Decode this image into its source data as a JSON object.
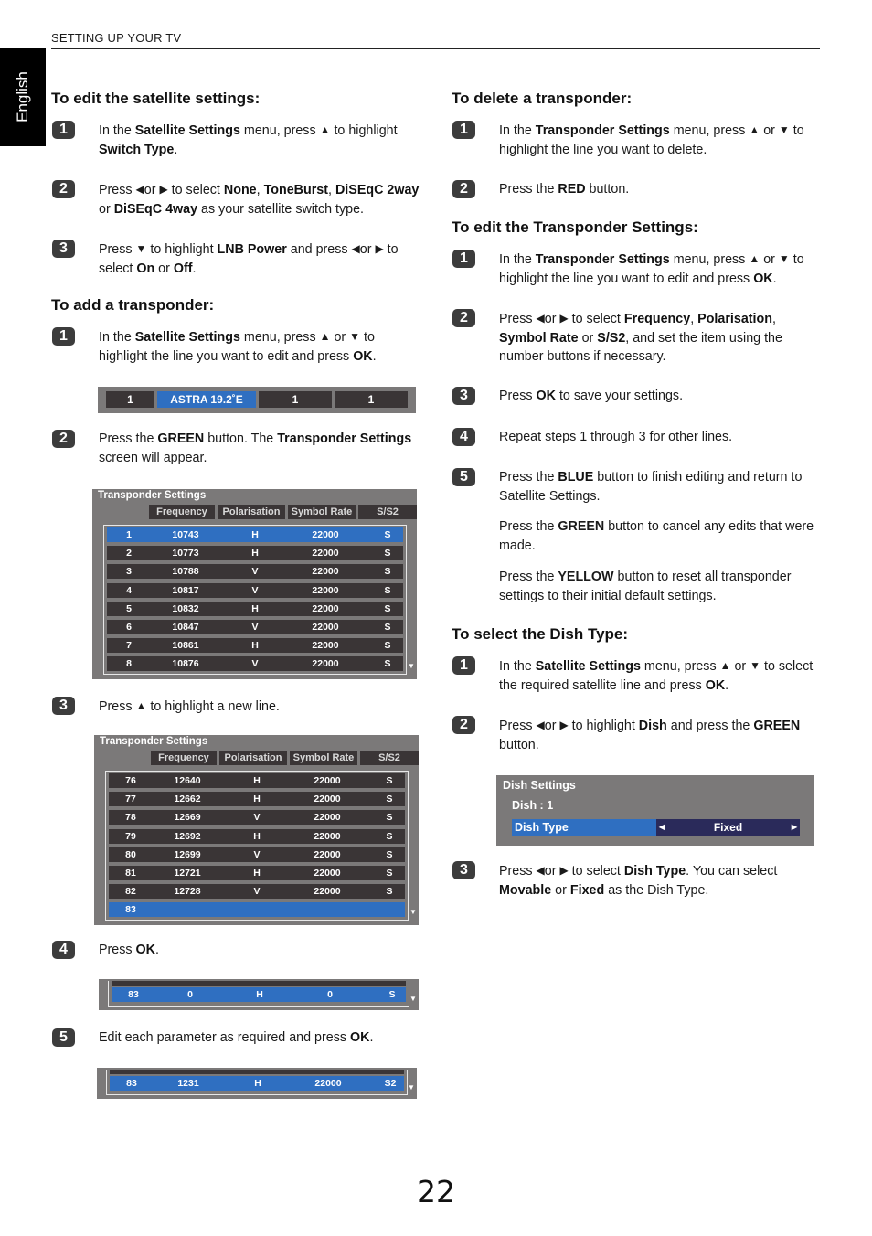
{
  "header": {
    "running_head": "SETTING UP YOUR TV",
    "language_tab": "English"
  },
  "page_number": "22",
  "left": {
    "edit_satellite": {
      "heading": "To edit the satellite settings:",
      "steps": [
        {
          "num": "1",
          "html": "In the <b>Satellite Settings</b> menu, press <span class='tri'>▲</span> to highlight <b>Switch Type</b>."
        },
        {
          "num": "2",
          "html": "Press <span class='tri'>◀</span>or <span class='tri'>▶</span> to select <b>None</b>, <b>ToneBurst</b>, <b>DiSEqC 2way</b> or <b>DiSEqC 4way</b> as your satellite switch type."
        },
        {
          "num": "3",
          "html": "Press <span class='tri'>▼</span> to highlight <b>LNB Power</b> and press <span class='tri'>◀</span>or <span class='tri'>▶</span> to select <b>On</b> or <b>Off</b>."
        }
      ]
    },
    "add_transponder": {
      "heading": "To add a transponder:",
      "steps": [
        {
          "num": "1",
          "html": "In the <b>Satellite Settings</b> menu, press <span class='tri'>▲</span> or <span class='tri'>▼</span> to highlight the line you want to edit and press <b>OK</b>."
        },
        {
          "num": "2",
          "html": "Press the <b>GREEN</b> button. The <b>Transponder Settings</b> screen will appear."
        },
        {
          "num": "3",
          "html": "Press <span class='tri'>▲</span> to highlight a new line."
        },
        {
          "num": "4",
          "html": "Press <b>OK</b>."
        },
        {
          "num": "5",
          "html": "Edit each parameter as required and press <b>OK</b>."
        }
      ]
    }
  },
  "satellite_strip": {
    "cells": [
      "1",
      "ASTRA 19.2˚E",
      "1",
      "1"
    ],
    "selected_index": 1
  },
  "transponder_screens": [
    {
      "title": "Transponder Settings",
      "columns": [
        "Frequency",
        "Polarisation",
        "Symbol Rate",
        "S/S2"
      ],
      "selected_row": 0,
      "rows": [
        [
          "1",
          "10743",
          "H",
          "22000",
          "S"
        ],
        [
          "2",
          "10773",
          "H",
          "22000",
          "S"
        ],
        [
          "3",
          "10788",
          "V",
          "22000",
          "S"
        ],
        [
          "4",
          "10817",
          "V",
          "22000",
          "S"
        ],
        [
          "5",
          "10832",
          "H",
          "22000",
          "S"
        ],
        [
          "6",
          "10847",
          "V",
          "22000",
          "S"
        ],
        [
          "7",
          "10861",
          "H",
          "22000",
          "S"
        ],
        [
          "8",
          "10876",
          "V",
          "22000",
          "S"
        ]
      ]
    },
    {
      "title": "Transponder Settings",
      "columns": [
        "Frequency",
        "Polarisation",
        "Symbol Rate",
        "S/S2"
      ],
      "selected_row": 7,
      "rows": [
        [
          "76",
          "12640",
          "H",
          "22000",
          "S"
        ],
        [
          "77",
          "12662",
          "H",
          "22000",
          "S"
        ],
        [
          "78",
          "12669",
          "V",
          "22000",
          "S"
        ],
        [
          "79",
          "12692",
          "H",
          "22000",
          "S"
        ],
        [
          "80",
          "12699",
          "V",
          "22000",
          "S"
        ],
        [
          "81",
          "12721",
          "H",
          "22000",
          "S"
        ],
        [
          "82",
          "12728",
          "V",
          "22000",
          "S"
        ],
        [
          "83",
          "",
          "",
          "",
          ""
        ]
      ]
    }
  ],
  "new_line_strip": [
    "83",
    "0",
    "H",
    "0",
    "S"
  ],
  "edited_line_strip": [
    "83",
    "1231",
    "H",
    "22000",
    "S2"
  ],
  "right": {
    "delete_transponder": {
      "heading": "To delete a transponder:",
      "steps": [
        {
          "num": "1",
          "html": "In the <b>Transponder Settings</b> menu, press <span class='tri'>▲</span> or <span class='tri'>▼</span> to highlight the line you want to delete."
        },
        {
          "num": "2",
          "html": "Press the <b>RED</b> button."
        }
      ]
    },
    "edit_transponder": {
      "heading": "To edit the Transponder Settings:",
      "steps": [
        {
          "num": "1",
          "html": "In the <b>Transponder Settings</b> menu, press <span class='tri'>▲</span> or <span class='tri'>▼</span> to highlight the line you want to edit and press <b>OK</b>."
        },
        {
          "num": "2",
          "html": "Press <span class='tri'>◀</span>or <span class='tri'>▶</span> to select <b>Frequency</b>, <b>Polarisation</b>, <b>Symbol Rate</b> or <b>S/S2</b>, and set the item using the number buttons if necessary."
        },
        {
          "num": "3",
          "html": "Press <b>OK</b> to save your settings."
        },
        {
          "num": "4",
          "html": "Repeat steps 1 through 3 for other lines."
        },
        {
          "num": "5",
          "html": "Press the <b>BLUE</b> button to finish editing and return to Satellite Settings."
        }
      ],
      "notes": [
        "Press the <b>GREEN</b> button to cancel any edits that were made.",
        "Press the <b>YELLOW</b> button to reset all transponder settings to their initial default settings."
      ]
    },
    "dish_type": {
      "heading": "To select the Dish Type:",
      "steps": [
        {
          "num": "1",
          "html": "In the <b>Satellite Settings</b> menu, press <span class='tri'>▲</span> or <span class='tri'>▼</span> to select the required satellite line and press <b>OK</b>."
        },
        {
          "num": "2",
          "html": "Press <span class='tri'>◀</span>or <span class='tri'>▶</span> to highlight <b>Dish</b> and press the <b>GREEN</b> button."
        },
        {
          "num": "3",
          "html": "Press <span class='tri'>◀</span>or <span class='tri'>▶</span> to select <b>Dish Type</b>. You can select <b>Movable</b> or <b>Fixed</b> as the Dish Type."
        }
      ]
    }
  },
  "dish_settings": {
    "title": "Dish Settings",
    "dish_label": "Dish : 1",
    "item_label": "Dish Type",
    "item_value": "Fixed"
  },
  "colors": {
    "highlight_blue": "#2f6fc1",
    "panel_gray": "#7b7979",
    "row_dark": "#3a3536",
    "value_navy": "#2a2a5a"
  }
}
